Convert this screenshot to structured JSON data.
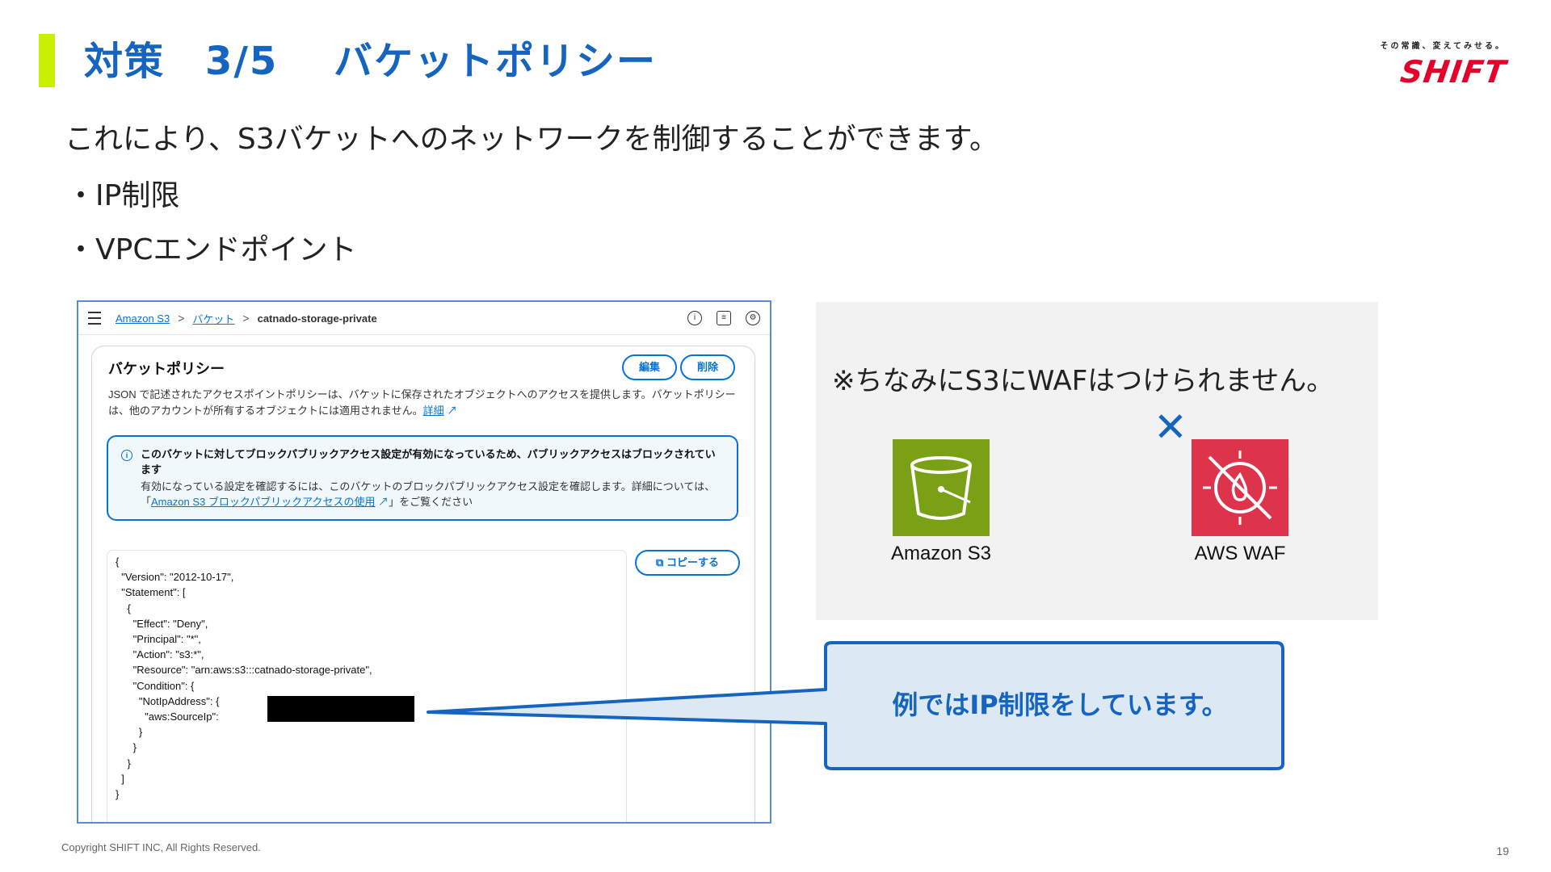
{
  "slide": {
    "title": "対策　3/5　 バケットポリシー",
    "lead": "これにより、S3バケットへのネットワークを制御することができます。",
    "bullets": [
      "・IP制限",
      "・VPCエンドポイント"
    ],
    "logo_tagline": "その常識、変えてみせる。",
    "logo_word": "SHIFT",
    "copyright": "Copyright SHIFT INC, All Rights Reserved.",
    "page_number": "19"
  },
  "console": {
    "breadcrumb": [
      "Amazon S3",
      "バケット",
      "catnado-storage-private"
    ],
    "card_title": "バケットポリシー",
    "edit_label": "編集",
    "delete_label": "削除",
    "description": "JSON で記述されたアクセスポイントポリシーは、バケットに保存されたオブジェクトへのアクセスを提供します。バケットポリシーは、他のアカウントが所有するオブジェクトには適用されません。",
    "description_link": "詳細",
    "info_title": "このバケットに対してブロックパブリックアクセス設定が有効になっているため、パブリックアクセスはブロックされています",
    "info_body_pre": "有効になっている設定を確認するには、このバケットのブロックパブリックアクセス設定を確認します。詳細については、「",
    "info_body_link": "Amazon S3 ブロックパブリックアクセスの使用",
    "info_body_post": "」をご覧ください",
    "copy_label": "コピーする",
    "policy_json": "{\n  \"Version\": \"2012-10-17\",\n  \"Statement\": [\n    {\n      \"Effect\": \"Deny\",\n      \"Principal\": \"*\",\n      \"Action\": \"s3:*\",\n      \"Resource\": \"arn:aws:s3:::catnado-storage-private\",\n      \"Condition\": {\n        \"NotIpAddress\": {\n          \"aws:SourceIp\":\n        }\n      }\n    }\n  ]\n}"
  },
  "aside": {
    "note": "※ちなみにS3にWAFはつけられません。",
    "cross": "✕",
    "s3_label": "Amazon S3",
    "waf_label": "AWS WAF"
  },
  "callout": {
    "text": "例ではIP制限をしています。"
  },
  "colors": {
    "accent_blue": "#1565c0",
    "link_blue": "#0972d3",
    "title_bar": "#c8f000",
    "s3_green": "#7aa116",
    "waf_red": "#dd344c",
    "callout_fill": "#dce9f5",
    "logo_red": "#e4002b"
  },
  "icons": [
    "menu-icon",
    "info-icon",
    "panel-icon",
    "settings-icon",
    "external-link-icon",
    "copy-icon",
    "bucket-icon",
    "firewall-icon",
    "cross-icon"
  ]
}
